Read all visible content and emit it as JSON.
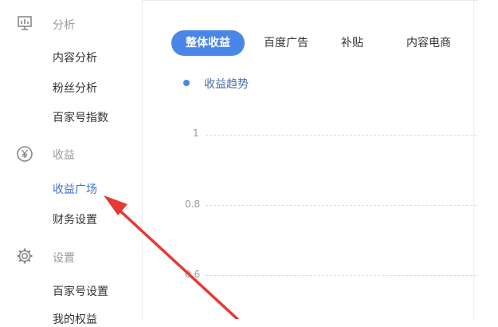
{
  "sidebar": {
    "sections": [
      {
        "title": "分析",
        "icon": "analytics-icon",
        "items": [
          "内容分析",
          "粉丝分析",
          "百家号指数"
        ]
      },
      {
        "title": "收益",
        "icon": "yen-icon",
        "items": [
          "收益广场",
          "财务设置"
        ]
      },
      {
        "title": "设置",
        "icon": "gear-icon",
        "items": [
          "百家号设置",
          "我的权益"
        ]
      }
    ],
    "active_item": "收益广场"
  },
  "tabs": [
    "整体收益",
    "百度广告",
    "补贴",
    "内容电商"
  ],
  "active_tab": "整体收益",
  "legend": {
    "label": "收益趋势",
    "color": "#4a86e8"
  },
  "chart_data": {
    "type": "line",
    "series": [
      {
        "name": "收益趋势",
        "values": []
      }
    ],
    "y_ticks": [
      "1",
      "0.8",
      "0.6"
    ],
    "grid": true
  },
  "colors": {
    "accent": "#4a86e8",
    "active_link": "#3b74d4",
    "annotation_arrow": "#e53935"
  }
}
